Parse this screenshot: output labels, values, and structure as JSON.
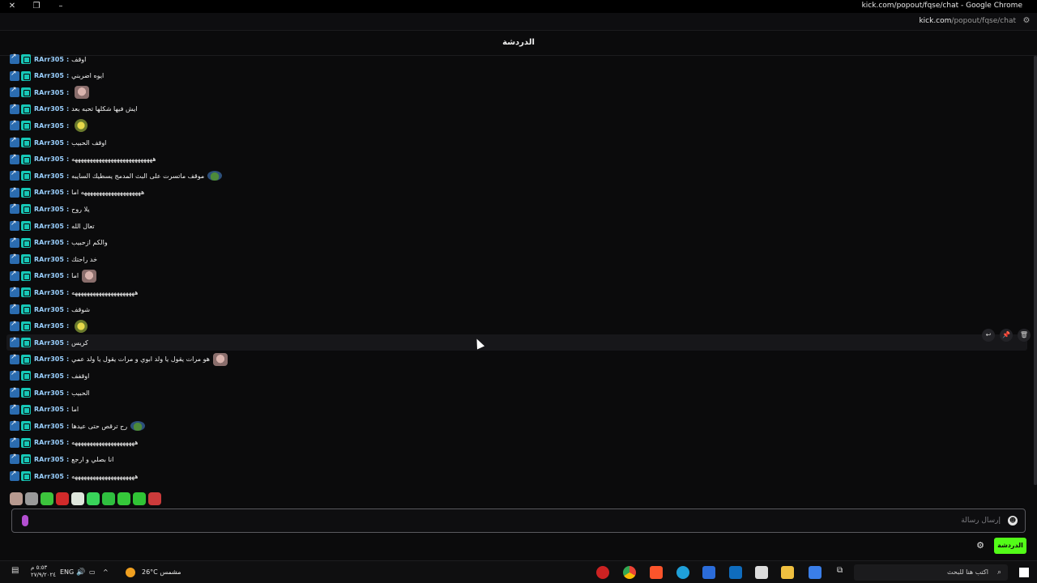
{
  "browser": {
    "window_title": "kick.com/popout/fqse/chat - Google Chrome",
    "url_host": "kick.com",
    "url_path": "/popout/fqse/chat"
  },
  "chat": {
    "header_title": "الدردشة",
    "messages": [
      {
        "user": "RArr305",
        "text": "اوقف",
        "emote": ""
      },
      {
        "user": "RArr305",
        "text": "ايوه اضربني",
        "emote": ""
      },
      {
        "user": "RArr305",
        "text": "",
        "emote": "cat"
      },
      {
        "user": "RArr305",
        "text": "ايش فيها شكلها تحبه بعد",
        "emote": ""
      },
      {
        "user": "RArr305",
        "text": "",
        "emote": "banana"
      },
      {
        "user": "RArr305",
        "text": "اوقف الحبيب",
        "emote": ""
      },
      {
        "user": "RArr305",
        "text": "هههههههههههههههههههههههههههه",
        "emote": ""
      },
      {
        "user": "RArr305",
        "text": "موقف ماتسرت على البث المدمج يسطيك السايبه",
        "emote": "pepe"
      },
      {
        "user": "RArr305",
        "text": "ههههههههههههههههههههه اما",
        "emote": ""
      },
      {
        "user": "RArr305",
        "text": "يلا روح",
        "emote": ""
      },
      {
        "user": "RArr305",
        "text": "تعال الله",
        "emote": ""
      },
      {
        "user": "RArr305",
        "text": "والكم ازحبيب",
        "emote": ""
      },
      {
        "user": "RArr305",
        "text": "خد راحتك",
        "emote": ""
      },
      {
        "user": "RArr305",
        "text": "اما",
        "emote": "cat"
      },
      {
        "user": "RArr305",
        "text": "هههههههههههههههههههههه",
        "emote": ""
      },
      {
        "user": "RArr305",
        "text": "شوقف",
        "emote": ""
      },
      {
        "user": "RArr305",
        "text": "",
        "emote": "banana"
      },
      {
        "user": "RArr305",
        "text": "كريس",
        "emote": ""
      },
      {
        "user": "RArr305",
        "text": "هو مرات يقول يا ولد ابوي و مرات يقول يا ولد عمي",
        "emote": "cat"
      },
      {
        "user": "RArr305",
        "text": "اوقفف",
        "emote": ""
      },
      {
        "user": "RArr305",
        "text": "الحبيب",
        "emote": ""
      },
      {
        "user": "RArr305",
        "text": "اما",
        "emote": ""
      },
      {
        "user": "RArr305",
        "text": "رح ترقص حتى عيدها",
        "emote": "pepe"
      },
      {
        "user": "RArr305",
        "text": "هههههههههههههههههههههه",
        "emote": ""
      },
      {
        "user": "RArr305",
        "text": "انا بصلي و ارجع",
        "emote": ""
      },
      {
        "user": "RArr305",
        "text": "هههههههههههههههههههههه",
        "emote": ""
      }
    ],
    "input_placeholder": "إرسال رسالة",
    "send_label": "الدردشة",
    "quick_emotes": [
      "cat-emote",
      "grumpy-cat-emote",
      "green-face-emote",
      "red-face-emote",
      "ball-emote",
      "green-frog-emote",
      "green-ball-emote",
      "green-blob-emote",
      "green-blob-2-emote",
      "red-mouth-emote"
    ]
  },
  "taskbar": {
    "search_placeholder": "اكتب هنا للبحث",
    "weather": "26°C مشمس",
    "lang": "ENG",
    "time": "٥:٥٣ م",
    "date": "٢٧/٩/٢٠٢٤"
  },
  "colors": {
    "accent_green": "#53fc18",
    "username": "#9ad0ff",
    "background": "#0b0b0c"
  }
}
